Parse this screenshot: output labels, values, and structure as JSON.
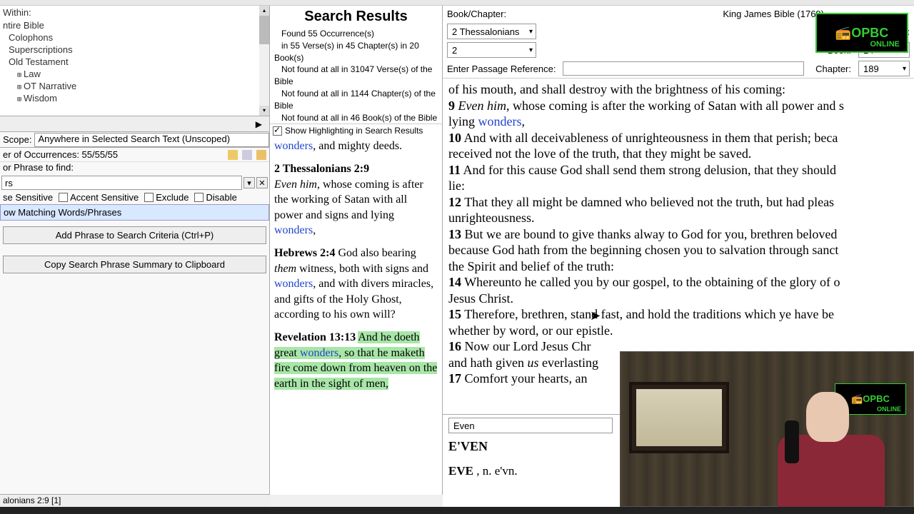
{
  "left": {
    "within_label": "Within:",
    "tree": [
      {
        "text": "ntire Bible",
        "indent": 0,
        "expander": ""
      },
      {
        "text": "Colophons",
        "indent": 1,
        "expander": ""
      },
      {
        "text": "Superscriptions",
        "indent": 1,
        "expander": ""
      },
      {
        "text": "Old Testament",
        "indent": 1,
        "expander": ""
      },
      {
        "text": "Law",
        "indent": 2,
        "expander": "⊞"
      },
      {
        "text": "OT Narrative",
        "indent": 2,
        "expander": "⊞"
      },
      {
        "text": "Wisdom",
        "indent": 2,
        "expander": "⊞"
      }
    ],
    "breadcrumb_arrow": "▶",
    "scope_label": "Scope:",
    "scope_value": "Anywhere in Selected Search Text (Unscoped)",
    "occurrences_label": "er of Occurrences: 55/55/55",
    "phrase_label": "or Phrase to find:",
    "phrase_value": "rs",
    "checks": {
      "case": "se Sensitive",
      "accent": "Accent Sensitive",
      "exclude": "Exclude",
      "disable": "Disable"
    },
    "matching": "ow Matching Words/Phrases",
    "add_button": "Add Phrase to Search Criteria (Ctrl+P)",
    "copy_button": "Copy Search Phrase Summary to Clipboard"
  },
  "results": {
    "title": "Search Results",
    "line1": "Found 55 Occurrence(s)",
    "line2": "in 55 Verse(s) in 45 Chapter(s) in 20 Book(s)",
    "line3": "Not found at all in 31047 Verse(s) of the Bible",
    "line4": "Not found at all in 1144 Chapter(s) of the Bible",
    "line5": "Not found at all in 46 Book(s) of the Bible",
    "highlight_check": "Show Highlighting in Search Results",
    "entries": [
      {
        "ref": "",
        "text_pre": "",
        "wonder": "wonders",
        "text_post": ", and mighty deeds."
      },
      {
        "ref": "2 Thessalonians 2:9",
        "italic": "Even him",
        "text": ", whose coming is after the working of Satan with all power and signs and lying ",
        "wonder": "wonders",
        "tail": ","
      },
      {
        "ref": "Hebrews 2:4",
        "text_pre": "God also bearing ",
        "italic": "them",
        "text": " witness, both with signs and ",
        "wonder": "wonders",
        "tail": ", and with divers miracles, and gifts of the Holy Ghost, according to his own will?"
      },
      {
        "ref": "Revelation 13:13",
        "hl_pre": "And he doeth great ",
        "wonder": "wonders",
        "hl_post": ", so that he maketh fire come down from heaven on the earth in the sight of men,"
      }
    ]
  },
  "right": {
    "bookchap_label": "Book/Chapter:",
    "bible_title": "King James Bible (1769)",
    "testament_label": "New Testament:",
    "book_dropdown": "2 Thessalonians",
    "chapter_dropdown": "2",
    "book_label": "Book:",
    "book_num": "14",
    "chapter_label": "Chapter:",
    "chapter_num": "189",
    "ref_label": "Enter Passage Reference:",
    "verses": [
      {
        "n": "",
        "text": "of his mouth, and shall destroy with the brightness of his coming:"
      },
      {
        "n": "9",
        "italic": "Even him",
        "text": ", whose coming is after the working of Satan with all power and s",
        "text2": "lying ",
        "wonder": "wonders",
        "tail": ","
      },
      {
        "n": "10",
        "text": "And with all deceivableness of unrighteousness in them that perish; beca",
        "text2": "received not the love of the truth, that they might be saved."
      },
      {
        "n": "11",
        "text": "And for this cause God shall send them strong delusion, that they should",
        "text2": "lie:"
      },
      {
        "n": "12",
        "text": "That they all might be damned who believed not the truth, but had pleas",
        "text2": "unrighteousness."
      },
      {
        "n": "13",
        "text": "But we are bound to give thanks alway to God for you, brethren beloved",
        "text2": "because God hath from the beginning chosen you to salvation through sanct",
        "text3": "the Spirit and belief of the truth:"
      },
      {
        "n": "14",
        "text": "Whereunto he called you by our gospel, to the obtaining of the glory of o",
        "text2": "Jesus Christ."
      },
      {
        "n": "15",
        "text": "Therefore, brethren, stand fast, and hold the traditions which ye have be",
        "text2": "whether by word, or our epistle."
      },
      {
        "n": "16",
        "text": "Now our Lord Jesus Chr",
        "text2": "and hath given ",
        "italic2": "us",
        "text3": " everlasting"
      },
      {
        "n": "17",
        "text": "Comfort your hearts, an"
      }
    ],
    "logo": "📻OPBC"
  },
  "dict": {
    "search": "Even",
    "head": "E'VEN",
    "entry_bold": "EVE",
    "entry_rest": " , n. e'vn."
  },
  "status": "alonians 2:9 [1]",
  "video_logo": "📻OPBC"
}
